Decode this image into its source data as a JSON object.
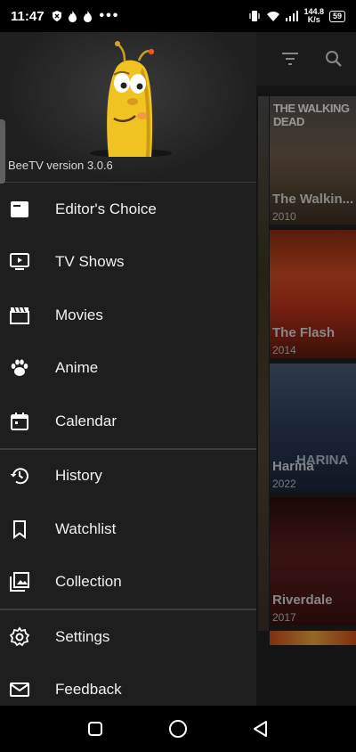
{
  "status_bar": {
    "time": "11:47",
    "dots": "•••",
    "net_speed_value": "144.8",
    "net_speed_unit": "K/s",
    "battery": "59"
  },
  "drawer": {
    "version_text": "BeeTV version 3.0.6",
    "items": [
      {
        "label": "Editor's Choice",
        "icon": "editors-choice-icon"
      },
      {
        "label": "TV Shows",
        "icon": "tv-icon"
      },
      {
        "label": "Movies",
        "icon": "movie-clapper-icon"
      },
      {
        "label": "Anime",
        "icon": "paw-icon"
      },
      {
        "label": "Calendar",
        "icon": "calendar-icon"
      },
      {
        "label": "History",
        "icon": "history-icon"
      },
      {
        "label": "Watchlist",
        "icon": "bookmark-icon"
      },
      {
        "label": "Collection",
        "icon": "collection-icon"
      },
      {
        "label": "Settings",
        "icon": "gear-icon"
      },
      {
        "label": "Feedback",
        "icon": "mail-icon"
      }
    ]
  },
  "posters": [
    {
      "title": "The Walkin...",
      "year": "2010",
      "top_text": "THE WALKING DEAD",
      "color": "#6b5a45"
    },
    {
      "title": "The Flash",
      "year": "2014",
      "color": "#b8321c"
    },
    {
      "title": "Harina",
      "year": "2022",
      "top_text": "HARINA",
      "color": "#2a3a55"
    },
    {
      "title": "Riverdale",
      "year": "2017",
      "color": "#5a1d1d"
    }
  ],
  "colors": {
    "drawer_bg": "#1e1e1e",
    "divider": "#3d3d3d",
    "text": "#f0f0f0"
  }
}
